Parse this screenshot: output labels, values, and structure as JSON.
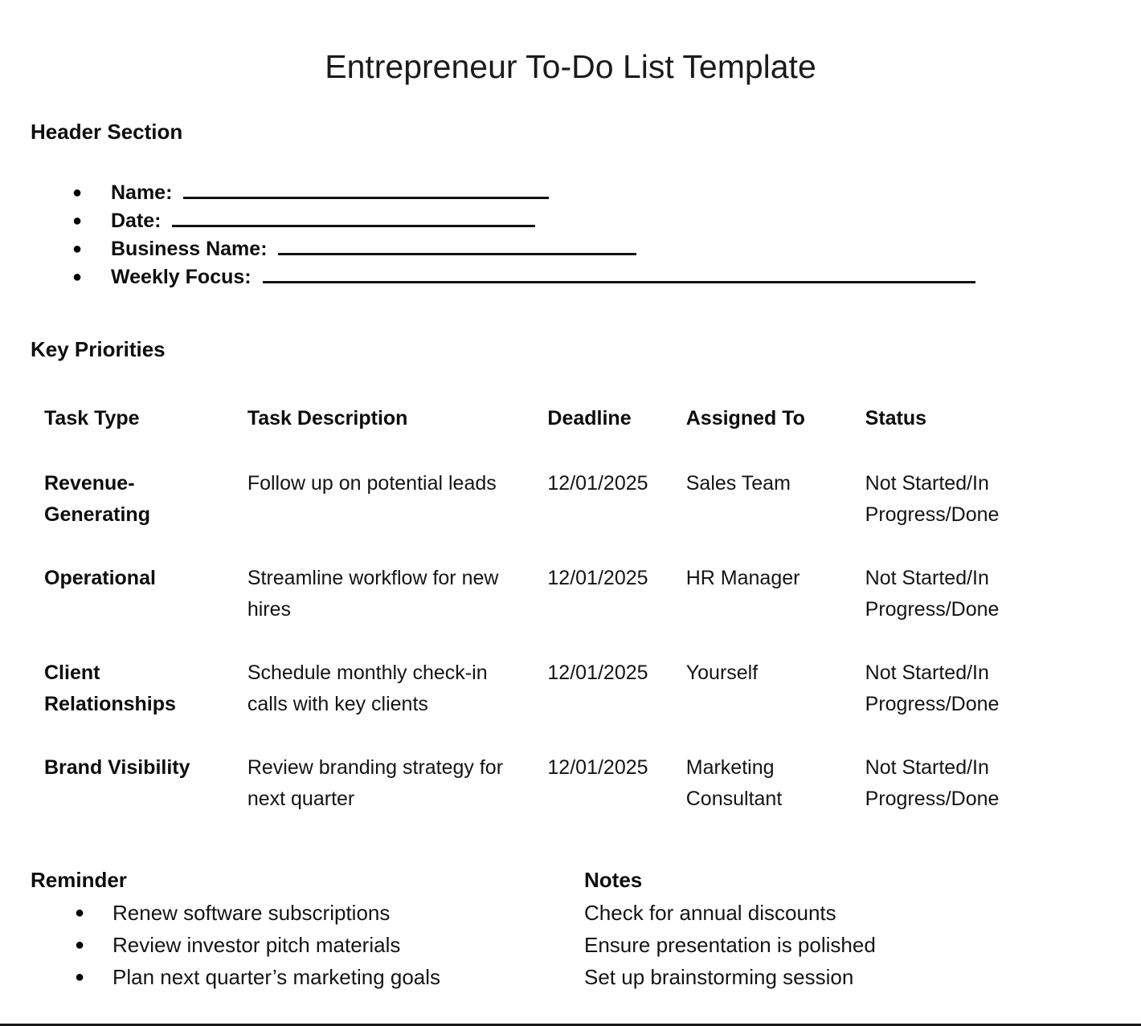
{
  "document": {
    "title": "Entrepreneur To-Do List Template"
  },
  "header_section": {
    "heading": "Header Section",
    "bullet_glyph": "●",
    "fields": [
      {
        "label": "Name:",
        "value": "",
        "blank": "_______________________________"
      },
      {
        "label": "Date:",
        "value": "",
        "blank": "_____________________________"
      },
      {
        "label": "Business Name:",
        "value": "",
        "blank": "_____________________________"
      },
      {
        "label": "Weekly Focus:",
        "value": "",
        "blank": "_______________________________________________________________"
      }
    ]
  },
  "key_priorities": {
    "heading": "Key Priorities",
    "columns": [
      "Task Type",
      "Task Description",
      "Deadline",
      "Assigned To",
      "Status"
    ],
    "rows": [
      {
        "task_type": "Revenue-Generating",
        "task_description": "Follow up on potential leads",
        "deadline": "12/01/2025",
        "assigned_to": "Sales Team",
        "status": "Not Started/In Progress/Done"
      },
      {
        "task_type": "Operational",
        "task_description": "Streamline workflow for new hires",
        "deadline": "12/01/2025",
        "assigned_to": "HR Manager",
        "status": "Not Started/In Progress/Done"
      },
      {
        "task_type": "Client Relationships",
        "task_description": "Schedule monthly check-in calls with key clients",
        "deadline": "12/01/2025",
        "assigned_to": "Yourself",
        "status": "Not Started/In Progress/Done"
      },
      {
        "task_type": "Brand Visibility",
        "task_description": "Review branding strategy for next quarter",
        "deadline": "12/01/2025",
        "assigned_to": "Marketing Consultant",
        "status": "Not Started/In Progress/Done"
      }
    ]
  },
  "reminder": {
    "heading": "Reminder",
    "bullet_glyph": "●",
    "items": [
      "Renew software subscriptions",
      "Review investor pitch materials",
      "Plan next quarter’s marketing goals"
    ]
  },
  "notes": {
    "heading": "Notes",
    "items": [
      "Check for annual discounts",
      "Ensure presentation is polished",
      "Set up brainstorming session"
    ]
  },
  "colors": {
    "page_background": "#ffffff",
    "text": "#111111",
    "rule": "#1a1a1a"
  }
}
